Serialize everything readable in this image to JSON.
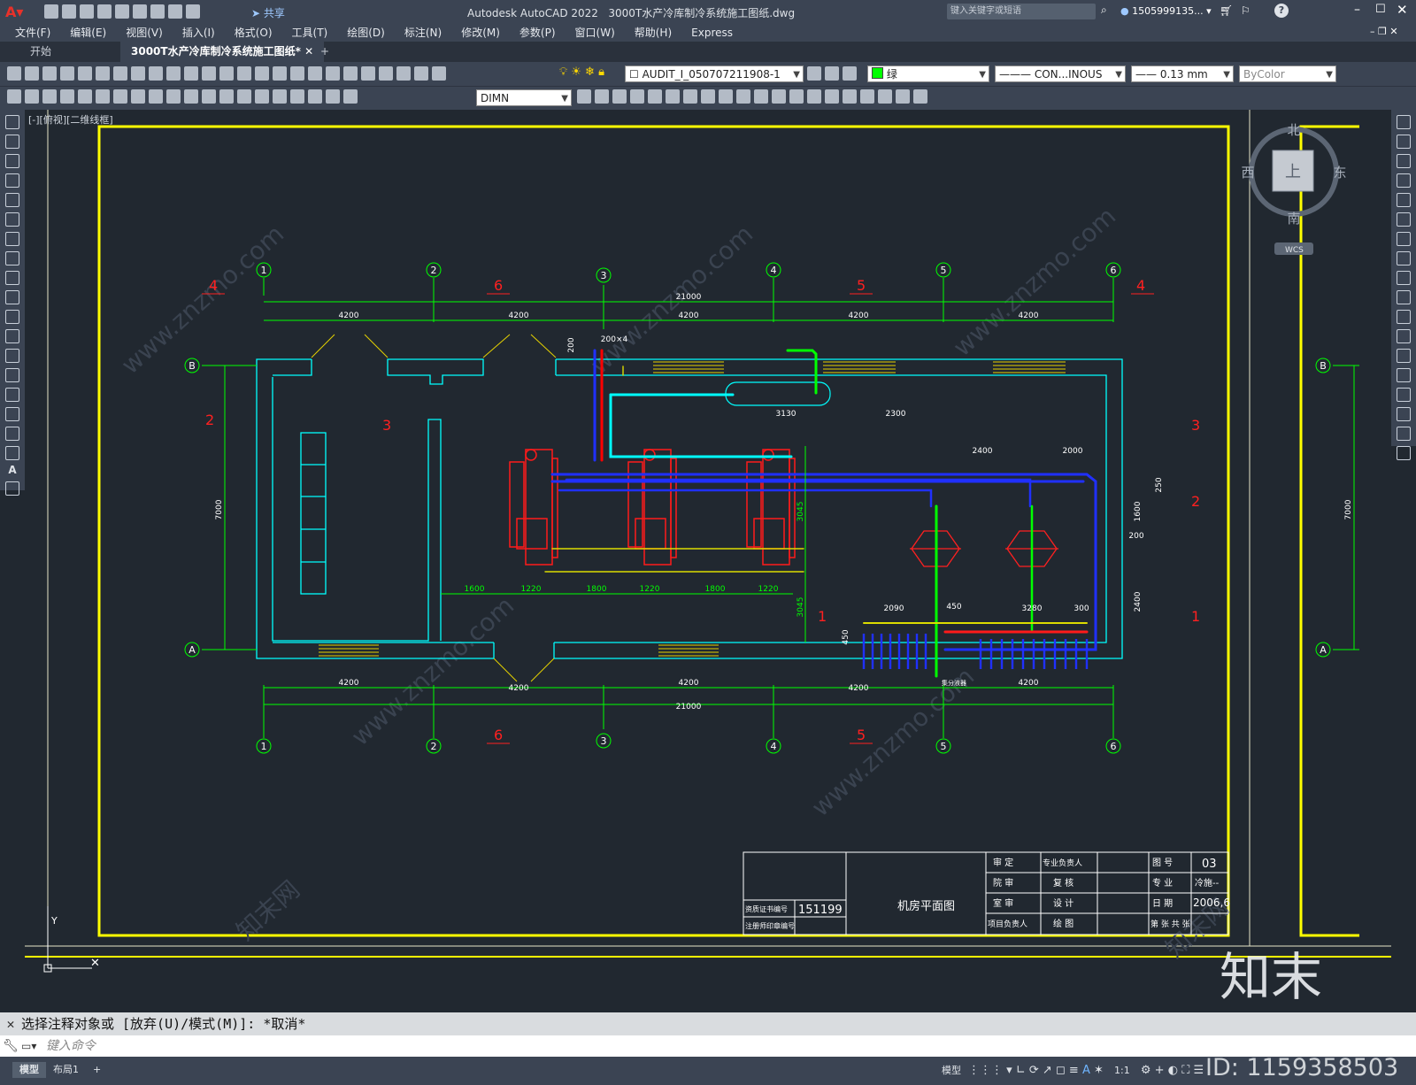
{
  "title_bar": {
    "app_title": "Autodesk AutoCAD 2022",
    "file_title": "3000T水产冷库制冷系统施工图纸.dwg",
    "share_label": "共享",
    "search_placeholder": "键入关键字或短语",
    "user": "1505999135...",
    "help_label": "?"
  },
  "menu": {
    "items": [
      "文件(F)",
      "编辑(E)",
      "视图(V)",
      "插入(I)",
      "格式(O)",
      "工具(T)",
      "绘图(D)",
      "标注(N)",
      "修改(M)",
      "参数(P)",
      "窗口(W)",
      "帮助(H)",
      "Express"
    ]
  },
  "tabs": {
    "items": [
      {
        "label": "开始",
        "active": false
      },
      {
        "label": "3000T水产冷库制冷系统施工图纸*",
        "active": true
      }
    ],
    "add_label": "+"
  },
  "toolbar": {
    "layer_value": "AUDIT_I_050707211908-1",
    "color_value": "绿",
    "linetype_value": "CON...INOUS",
    "lineweight_value": "0.13 mm",
    "plotstyle_value": "ByColor",
    "dimstyle_value": "DIMN"
  },
  "viewport": {
    "label": "[-][俯视][二维线框]",
    "viewcube": {
      "north": "北",
      "south": "南",
      "east": "东",
      "west": "西",
      "top": "上",
      "wcs": "WCS"
    }
  },
  "drawing": {
    "axis_top_labels": [
      "1",
      "2",
      "3",
      "4",
      "5",
      "6"
    ],
    "axis_side_labels": [
      "B",
      "A"
    ],
    "top_dims": [
      "4200",
      "4200",
      "4200",
      "4200",
      "4200"
    ],
    "total_dim": "21000",
    "left_dim": "7000",
    "right_dim": "7000",
    "section_marks_top": [
      "4",
      "6",
      "5",
      "4"
    ],
    "section_marks_bottom": [
      "6",
      "5"
    ],
    "section_marks_side": [
      "2",
      "3",
      "3",
      "2",
      "1",
      "1"
    ],
    "equip_dims": [
      "1600",
      "1220",
      "1800",
      "1220",
      "1800",
      "1220"
    ],
    "vertical_dims": [
      "3045",
      "3045"
    ],
    "receiver_dims": [
      "3130",
      "2300",
      "200×4",
      "200"
    ],
    "right_dims": [
      "2400",
      "2000",
      "250",
      "1600",
      "200",
      "2400"
    ],
    "manifold_dims": [
      "2090",
      "450",
      "3280",
      "300",
      "450"
    ],
    "manifold_label": "集分液器"
  },
  "title_block": {
    "drawing_name": "机房平面图",
    "cert_label": "资质证书编号",
    "cert_number": "151199",
    "reg_label": "注册师印章编号",
    "roles": [
      "审 定",
      "院 审",
      "室 审",
      "项目负责人"
    ],
    "roles2": [
      "专业负责人",
      "复 核",
      "设 计",
      "绘 图"
    ],
    "fields": [
      "图 号",
      "专 业",
      "日 期",
      "第 张 共 张"
    ],
    "values": [
      "03",
      "冷施--",
      "2006,6",
      ""
    ]
  },
  "command": {
    "history": "选择注释对象或 [放弃(U)/模式(M)]: *取消*",
    "placeholder": "键入命令"
  },
  "status": {
    "layout_tabs": [
      "模型",
      "布局1"
    ],
    "model_label": "模型",
    "scale": "1:1"
  },
  "watermark": {
    "brand": "知末",
    "id": "ID: 1159358503",
    "url": "www.znzmo.com",
    "cn": "知末网"
  },
  "colors": {
    "canvas_bg": "#212830",
    "frame": "#ffff00",
    "wall": "#00ffff",
    "axis": "#00ff00",
    "section": "#ff0000",
    "pipe_blue": "#0000ff",
    "pipe_red": "#ff0000"
  }
}
